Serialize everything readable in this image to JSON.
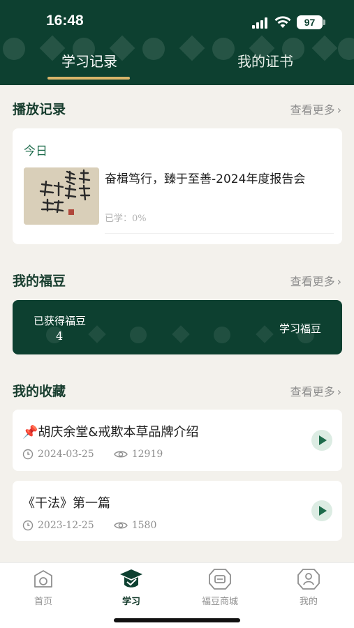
{
  "status_bar": {
    "time": "16:48",
    "battery": "97"
  },
  "tabs": [
    {
      "label": "学习记录",
      "active": true
    },
    {
      "label": "我的证书",
      "active": false
    }
  ],
  "play_history": {
    "title": "播放记录",
    "more": "查看更多",
    "day": "今日",
    "item": {
      "title": "奋楫笃行，臻于至善-2024年度报告会",
      "progress": "已学：0%"
    }
  },
  "beans": {
    "title": "我的福豆",
    "more": "查看更多",
    "earned_label": "已获得福豆",
    "count": "4",
    "learn_link": "学习福豆"
  },
  "favorites": {
    "title": "我的收藏",
    "more": "查看更多",
    "items": [
      {
        "title": "📌胡庆余堂&戒欺本草品牌介绍",
        "date": "2024-03-25",
        "views": "12919"
      },
      {
        "title": "《干法》第一篇",
        "date": "2023-12-25",
        "views": "1580"
      }
    ]
  },
  "tabbar": [
    {
      "label": "首页",
      "icon": "home-icon"
    },
    {
      "label": "学习",
      "icon": "graduation-cap-icon",
      "active": true
    },
    {
      "label": "福豆商城",
      "icon": "shop-icon"
    },
    {
      "label": "我的",
      "icon": "profile-icon"
    }
  ],
  "colors": {
    "primary": "#0d4030",
    "accent": "#d9b56a",
    "green_text": "#1d6b4b",
    "background": "#f3f1ec"
  }
}
